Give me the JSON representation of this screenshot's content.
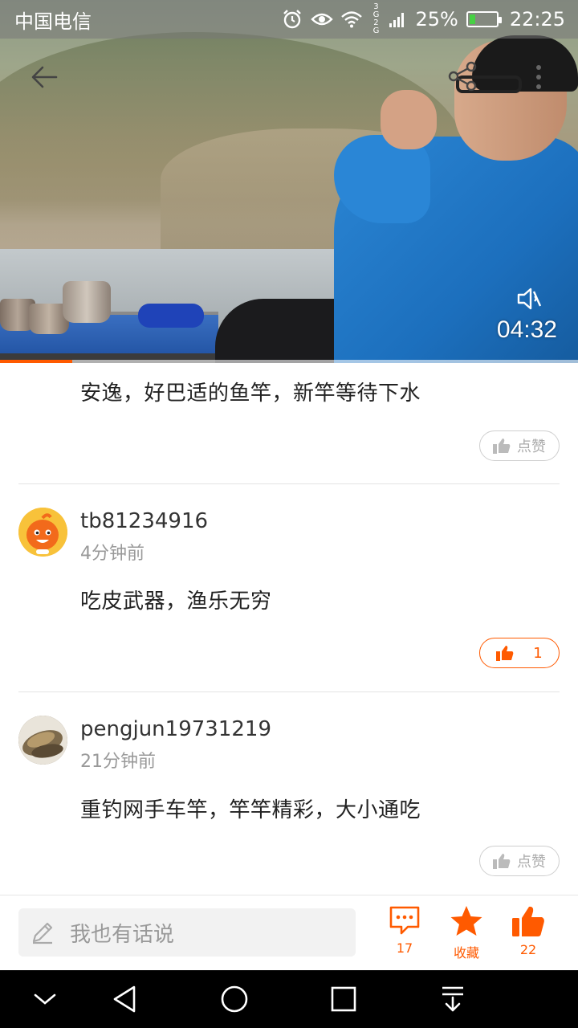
{
  "status_bar": {
    "carrier": "中国电信",
    "network": "3G 2G",
    "battery_percent": "25%",
    "battery_level": 0.25,
    "time": "22:25"
  },
  "video": {
    "duration": "04:32",
    "progress_fraction": 0.125,
    "muted": true
  },
  "comments": [
    {
      "username": "",
      "time": "",
      "content": "安逸，好巴适的鱼竿，新竿等待下水",
      "like_label": "点赞",
      "liked": false
    },
    {
      "username": "tb81234916",
      "time": "4分钟前",
      "content": "吃皮武器，渔乐无穷",
      "like_label": "1",
      "liked": true
    },
    {
      "username": "pengjun19731219",
      "time": "21分钟前",
      "content": "重钓网手车竿，竿竿精彩，大小通吃",
      "like_label": "点赞",
      "liked": false
    }
  ],
  "action_bar": {
    "input_placeholder": "我也有话说",
    "comment_count": "17",
    "favorite_label": "收藏",
    "like_count": "22"
  },
  "colors": {
    "accent": "#ff5a00",
    "text_primary": "#222222",
    "text_secondary": "#999999",
    "divider": "#e3e3e3"
  },
  "icons": {
    "back": "arrow-left-icon",
    "share": "share-icon",
    "more": "more-vertical-icon",
    "mute": "speaker-muted-icon",
    "like": "thumbs-up-icon",
    "comment": "comment-bubble-icon",
    "favorite": "star-icon",
    "edit": "pencil-icon"
  }
}
